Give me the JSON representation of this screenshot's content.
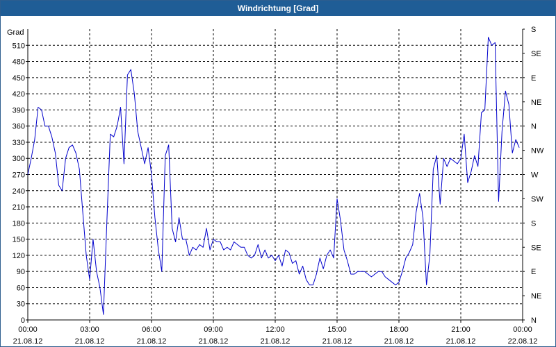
{
  "window": {
    "title": "Windrichtung [Grad]"
  },
  "colors": {
    "title_bar": "#1f5d96",
    "line": "#0000cc",
    "grid": "#000000"
  },
  "chart_data": {
    "type": "line",
    "title": "Windrichtung [Grad]",
    "ylabel": "Grad",
    "xlabel": "",
    "ylim": [
      0,
      540
    ],
    "xlim_hours": [
      0,
      24
    ],
    "grid": true,
    "grid_style": "dashed",
    "y_ticks": [
      0,
      30,
      60,
      90,
      120,
      150,
      180,
      210,
      240,
      270,
      300,
      330,
      360,
      390,
      420,
      450,
      480,
      510
    ],
    "right_axis_labels": [
      "N",
      "NE",
      "E",
      "SE",
      "S",
      "SW",
      "W",
      "NW",
      "N",
      "NE",
      "E",
      "SE",
      "S"
    ],
    "x_ticks": [
      {
        "time": "00:00",
        "date": "21.08.12"
      },
      {
        "time": "03:00",
        "date": "21.08.12"
      },
      {
        "time": "06:00",
        "date": "21.08.12"
      },
      {
        "time": "09:00",
        "date": "21.08.12"
      },
      {
        "time": "12:00",
        "date": "21.08.12"
      },
      {
        "time": "15:00",
        "date": "21.08.12"
      },
      {
        "time": "18:00",
        "date": "21.08.12"
      },
      {
        "time": "21:00",
        "date": "21.08.12"
      },
      {
        "time": "00:00",
        "date": "22.08.12"
      }
    ],
    "series": [
      {
        "points": [
          [
            "00:00",
            270
          ],
          [
            "00:10",
            300
          ],
          [
            "00:20",
            335
          ],
          [
            "00:30",
            395
          ],
          [
            "00:40",
            390
          ],
          [
            "00:50",
            360
          ],
          [
            "01:00",
            360
          ],
          [
            "01:10",
            340
          ],
          [
            "01:20",
            310
          ],
          [
            "01:30",
            250
          ],
          [
            "01:40",
            240
          ],
          [
            "01:50",
            300
          ],
          [
            "02:00",
            320
          ],
          [
            "02:10",
            325
          ],
          [
            "02:20",
            310
          ],
          [
            "02:30",
            280
          ],
          [
            "02:40",
            200
          ],
          [
            "02:50",
            120
          ],
          [
            "03:00",
            75
          ],
          [
            "03:10",
            150
          ],
          [
            "03:20",
            90
          ],
          [
            "03:30",
            60
          ],
          [
            "03:40",
            10
          ],
          [
            "03:50",
            180
          ],
          [
            "04:00",
            345
          ],
          [
            "04:10",
            340
          ],
          [
            "04:20",
            360
          ],
          [
            "04:30",
            395
          ],
          [
            "04:40",
            290
          ],
          [
            "04:50",
            455
          ],
          [
            "05:00",
            465
          ],
          [
            "05:10",
            420
          ],
          [
            "05:20",
            350
          ],
          [
            "05:30",
            320
          ],
          [
            "05:40",
            290
          ],
          [
            "05:50",
            320
          ],
          [
            "06:00",
            270
          ],
          [
            "06:10",
            190
          ],
          [
            "06:20",
            130
          ],
          [
            "06:30",
            90
          ],
          [
            "06:40",
            305
          ],
          [
            "06:50",
            325
          ],
          [
            "07:00",
            170
          ],
          [
            "07:10",
            145
          ],
          [
            "07:20",
            190
          ],
          [
            "07:30",
            150
          ],
          [
            "07:40",
            150
          ],
          [
            "07:50",
            120
          ],
          [
            "08:00",
            135
          ],
          [
            "08:10",
            130
          ],
          [
            "08:20",
            140
          ],
          [
            "08:30",
            135
          ],
          [
            "08:40",
            170
          ],
          [
            "08:50",
            130
          ],
          [
            "09:00",
            150
          ],
          [
            "09:10",
            145
          ],
          [
            "09:20",
            145
          ],
          [
            "09:30",
            130
          ],
          [
            "09:40",
            135
          ],
          [
            "09:50",
            130
          ],
          [
            "10:00",
            145
          ],
          [
            "10:10",
            140
          ],
          [
            "10:20",
            135
          ],
          [
            "10:30",
            135
          ],
          [
            "10:40",
            120
          ],
          [
            "10:50",
            115
          ],
          [
            "11:00",
            120
          ],
          [
            "11:10",
            140
          ],
          [
            "11:20",
            115
          ],
          [
            "11:30",
            130
          ],
          [
            "11:40",
            115
          ],
          [
            "11:50",
            120
          ],
          [
            "12:00",
            110
          ],
          [
            "12:10",
            120
          ],
          [
            "12:20",
            100
          ],
          [
            "12:30",
            130
          ],
          [
            "12:40",
            125
          ],
          [
            "12:50",
            105
          ],
          [
            "13:00",
            110
          ],
          [
            "13:10",
            85
          ],
          [
            "13:20",
            100
          ],
          [
            "13:30",
            75
          ],
          [
            "13:40",
            65
          ],
          [
            "13:50",
            65
          ],
          [
            "14:00",
            85
          ],
          [
            "14:10",
            115
          ],
          [
            "14:20",
            95
          ],
          [
            "14:30",
            120
          ],
          [
            "14:40",
            130
          ],
          [
            "14:50",
            115
          ],
          [
            "15:00",
            225
          ],
          [
            "15:10",
            185
          ],
          [
            "15:20",
            130
          ],
          [
            "15:30",
            110
          ],
          [
            "15:40",
            85
          ],
          [
            "15:50",
            85
          ],
          [
            "16:00",
            90
          ],
          [
            "16:10",
            90
          ],
          [
            "16:20",
            90
          ],
          [
            "16:30",
            85
          ],
          [
            "16:40",
            80
          ],
          [
            "16:50",
            85
          ],
          [
            "17:00",
            90
          ],
          [
            "17:10",
            90
          ],
          [
            "17:20",
            80
          ],
          [
            "17:30",
            75
          ],
          [
            "17:40",
            70
          ],
          [
            "17:50",
            65
          ],
          [
            "18:00",
            70
          ],
          [
            "18:10",
            90
          ],
          [
            "18:20",
            115
          ],
          [
            "18:30",
            125
          ],
          [
            "18:40",
            140
          ],
          [
            "18:50",
            200
          ],
          [
            "19:00",
            235
          ],
          [
            "19:10",
            190
          ],
          [
            "19:20",
            65
          ],
          [
            "19:30",
            120
          ],
          [
            "19:40",
            280
          ],
          [
            "19:50",
            305
          ],
          [
            "20:00",
            215
          ],
          [
            "20:10",
            300
          ],
          [
            "20:20",
            285
          ],
          [
            "20:30",
            300
          ],
          [
            "20:40",
            295
          ],
          [
            "20:50",
            290
          ],
          [
            "21:00",
            300
          ],
          [
            "21:10",
            345
          ],
          [
            "21:20",
            255
          ],
          [
            "21:30",
            275
          ],
          [
            "21:40",
            305
          ],
          [
            "21:50",
            285
          ],
          [
            "22:00",
            385
          ],
          [
            "22:10",
            390
          ],
          [
            "22:20",
            525
          ],
          [
            "22:30",
            510
          ],
          [
            "22:40",
            515
          ],
          [
            "22:50",
            220
          ],
          [
            "23:00",
            350
          ],
          [
            "23:10",
            425
          ],
          [
            "23:20",
            400
          ],
          [
            "23:30",
            310
          ],
          [
            "23:40",
            335
          ],
          [
            "23:50",
            320
          ]
        ]
      }
    ]
  }
}
